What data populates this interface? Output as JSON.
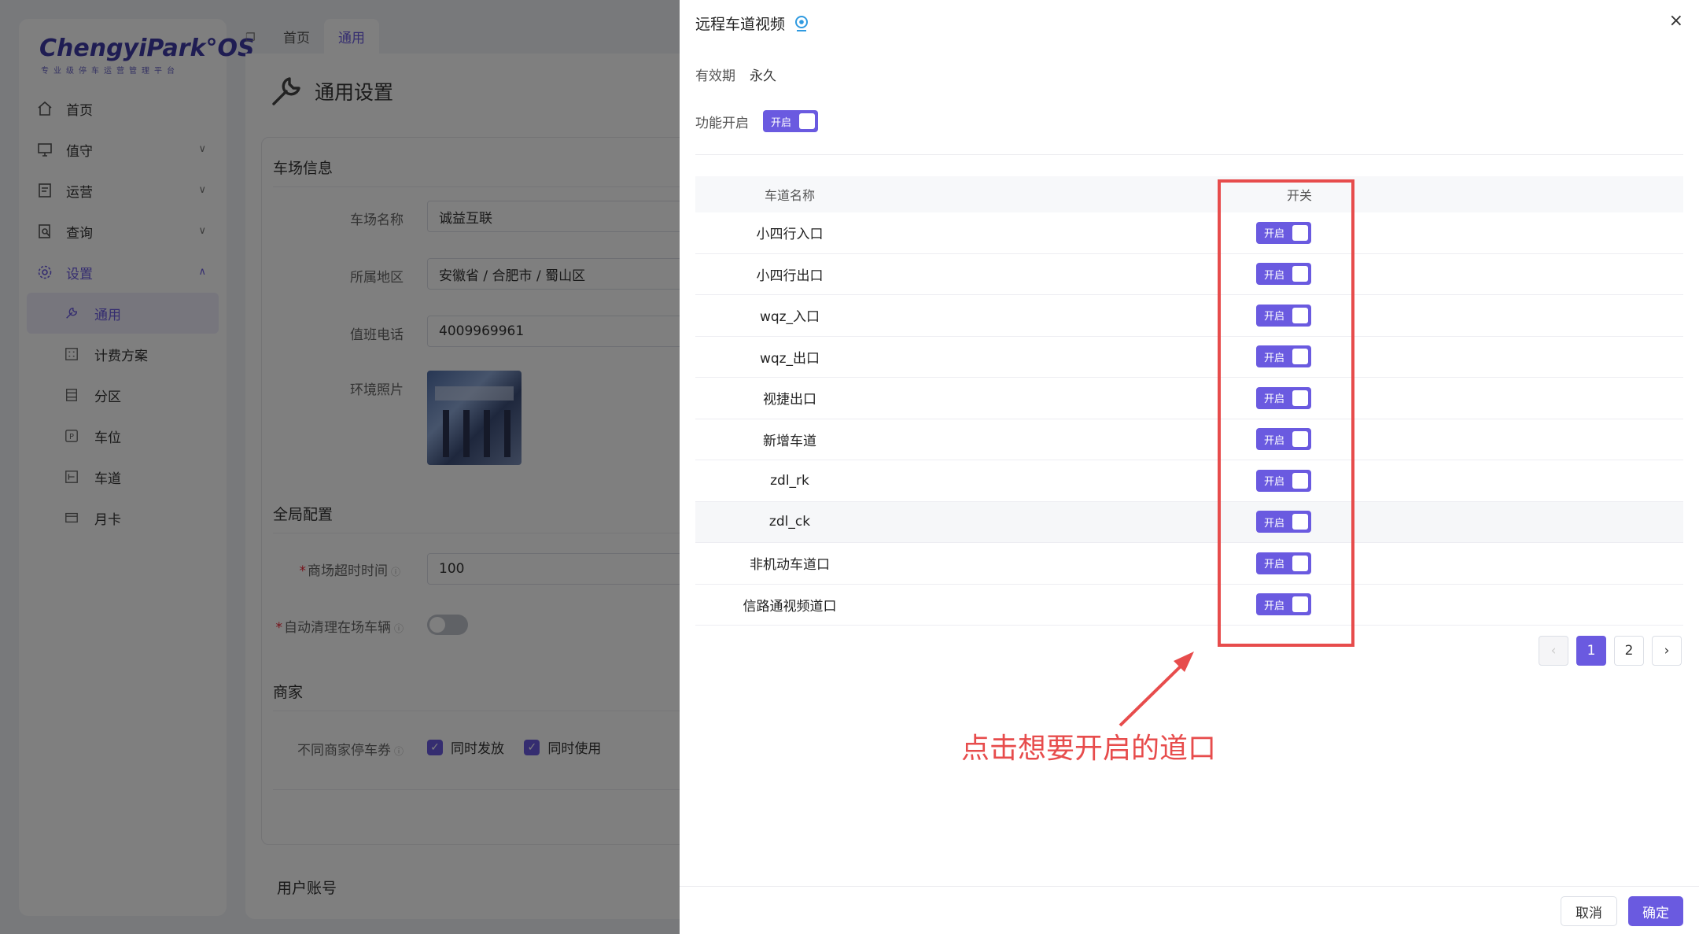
{
  "brand": {
    "logo": "ChengyiPark°OS",
    "tagline": "专业级停车运营管理平台"
  },
  "sidebar": {
    "items": [
      {
        "label": "首页",
        "icon": "home-icon"
      },
      {
        "label": "值守",
        "icon": "monitor-icon"
      },
      {
        "label": "运营",
        "icon": "report-icon"
      },
      {
        "label": "查询",
        "icon": "search-doc-icon"
      },
      {
        "label": "设置",
        "icon": "gear-icon"
      }
    ],
    "sub_items": [
      {
        "label": "通用",
        "icon": "wrench-icon"
      },
      {
        "label": "计费方案",
        "icon": "billing-icon"
      },
      {
        "label": "分区",
        "icon": "zone-icon"
      },
      {
        "label": "车位",
        "icon": "parking-icon"
      },
      {
        "label": "车道",
        "icon": "lane-icon"
      },
      {
        "label": "月卡",
        "icon": "card-icon"
      }
    ]
  },
  "tabs": [
    {
      "label": "首页"
    },
    {
      "label": "通用"
    }
  ],
  "page": {
    "title": "通用设置"
  },
  "form": {
    "sec_lot": "车场信息",
    "lot_name_label": "车场名称",
    "lot_name_value": "诚益互联",
    "region_label": "所属地区",
    "region_value": "安徽省 / 合肥市 / 蜀山区",
    "phone_label": "值班电话",
    "phone_value": "4009969961",
    "photo_label": "环境照片",
    "sec_global": "全局配置",
    "timeout_label": "商场超时时间",
    "timeout_value": "100",
    "autoclean_label": "自动清理在场车辆",
    "sec_merchant": "商家",
    "coupon_label": "不同商家停车券",
    "check1": "同时发放",
    "check2": "同时使用",
    "sec_account": "用户账号"
  },
  "drawer": {
    "title": "远程车道视频",
    "validity_label": "有效期",
    "validity_value": "永久",
    "func_label": "功能开启",
    "func_switch": "开启",
    "table": {
      "headers": [
        "车道名称",
        "开关"
      ],
      "rows": [
        {
          "name": "小四行入口",
          "switch": "开启"
        },
        {
          "name": "小四行出口",
          "switch": "开启"
        },
        {
          "name": "wqz_入口",
          "switch": "开启"
        },
        {
          "name": "wqz_出口",
          "switch": "开启"
        },
        {
          "name": "视捷出口",
          "switch": "开启"
        },
        {
          "name": "新增车道",
          "switch": "开启"
        },
        {
          "name": "zdl_rk",
          "switch": "开启"
        },
        {
          "name": "zdl_ck",
          "switch": "开启"
        },
        {
          "name": "非机动车道口",
          "switch": "开启"
        },
        {
          "name": "信路通视频道口",
          "switch": "开启"
        }
      ]
    },
    "pagination": {
      "prev": "‹",
      "pages": [
        "1",
        "2"
      ],
      "next": "›",
      "current": "1"
    },
    "annotation": "点击想要开启的道口",
    "cancel": "取消",
    "ok": "确定"
  },
  "colors": {
    "accent": "#6a5ae0",
    "annotation": "#e74c4c"
  }
}
